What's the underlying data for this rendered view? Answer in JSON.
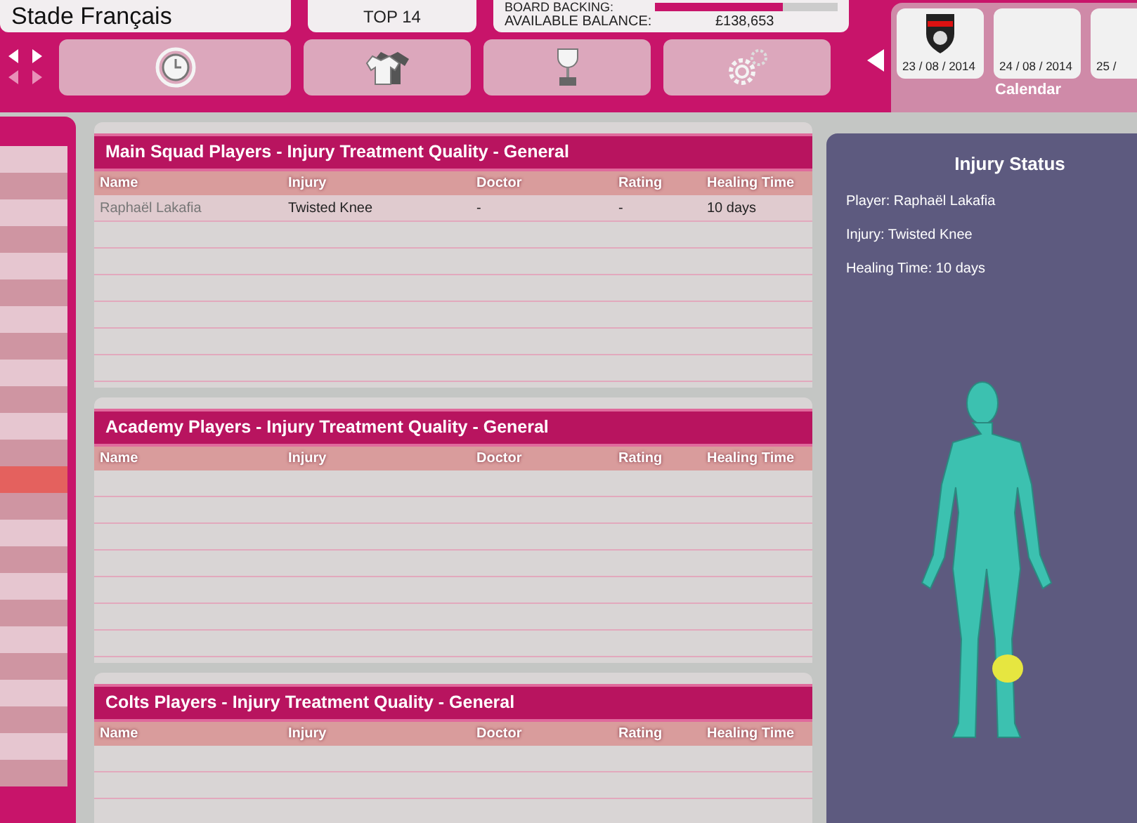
{
  "club": {
    "name": "Stade Français",
    "league": "TOP 14"
  },
  "finance": {
    "board_backing_label": "BOARD BACKING:",
    "board_backing": {
      "level": 0.7
    },
    "balance_label": "AVAILABLE BALANCE:",
    "balance": "£138,653"
  },
  "toolbar": [
    {
      "kind": "clock"
    },
    {
      "kind": "shirts"
    },
    {
      "kind": "trophy"
    },
    {
      "kind": "gears"
    }
  ],
  "calendar": {
    "label": "Calendar",
    "days": [
      {
        "date": "23 / 08 / 2014",
        "has_match": true
      },
      {
        "date": "24 / 08 / 2014",
        "has_match": false
      },
      {
        "date": "25 /",
        "has_match": false
      }
    ]
  },
  "sidebar": {
    "items": [
      {
        "selected": false
      },
      {
        "selected": false
      },
      {
        "selected": false
      },
      {
        "selected": false
      },
      {
        "selected": false
      },
      {
        "selected": false
      },
      {
        "selected": false
      },
      {
        "selected": false
      },
      {
        "selected": false
      },
      {
        "selected": false
      },
      {
        "selected": false
      },
      {
        "selected": false
      },
      {
        "selected": true
      },
      {
        "selected": false
      },
      {
        "selected": false
      },
      {
        "selected": false
      },
      {
        "selected": false
      },
      {
        "selected": false
      },
      {
        "selected": false
      },
      {
        "selected": false
      },
      {
        "selected": false
      },
      {
        "selected": false
      },
      {
        "selected": false
      },
      {
        "selected": false
      }
    ]
  },
  "tables": [
    {
      "title": "Main Squad Players - Injury Treatment Quality - General",
      "columns": [
        "Name",
        "Injury",
        "Doctor",
        "Rating",
        "Healing Time"
      ],
      "rows": [
        [
          "Raphaël Lakafia",
          "Twisted Knee",
          "-",
          "-",
          "10 days"
        ]
      ]
    },
    {
      "title": "Academy Players - Injury Treatment Quality - General",
      "columns": [
        "Name",
        "Injury",
        "Doctor",
        "Rating",
        "Healing Time"
      ]
    },
    {
      "title": "Colts Players - Injury Treatment Quality - General",
      "columns": [
        "Name",
        "Injury",
        "Doctor",
        "Rating",
        "Healing Time"
      ]
    }
  ],
  "injury_status": {
    "title": "Injury Status",
    "lines": [
      "Player: Raphaël Lakafia",
      "Injury: Twisted Knee",
      "Healing Time: 10 days"
    ]
  }
}
